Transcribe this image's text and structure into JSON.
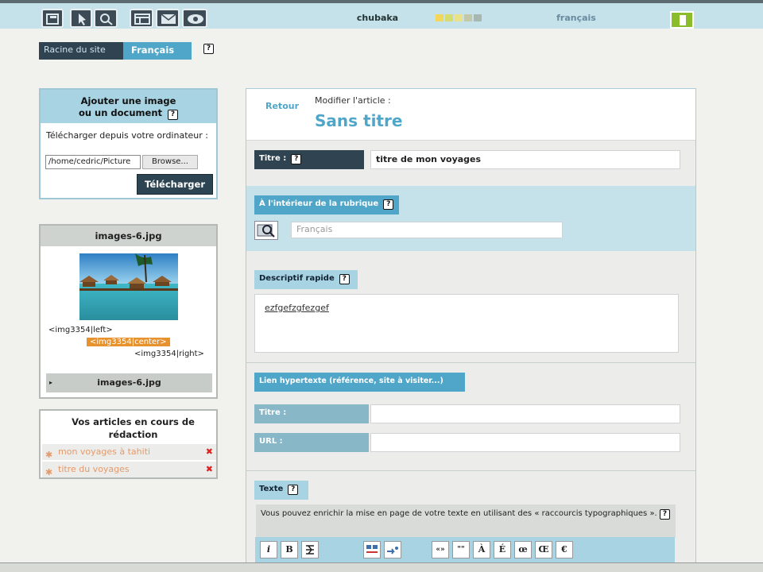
{
  "header": {
    "site_name": "chubaka",
    "language": "français",
    "swatches": [
      "#f4d65b",
      "#d6dd6e",
      "#e9e289",
      "#c3c8a8",
      "#a9b7b2"
    ]
  },
  "breadcrumb": {
    "root": "Racine du site",
    "current": "Français",
    "help": "?"
  },
  "upload": {
    "title": "Ajouter une image\nou un document",
    "help": "?",
    "instructions": "Télécharger depuis votre ordinateur :",
    "file_value": "/home/cedric/Picture",
    "browse_label": "Browse...",
    "submit_label": "Télécharger"
  },
  "image_panel": {
    "filename": "images-6.jpg",
    "tag_left": "<img3354|left>",
    "tag_center": "<img3354|center>",
    "tag_right": "<img3354|right>",
    "footer_arrow": "▸",
    "footer_label": "images-6.jpg"
  },
  "drafts": {
    "title": "Vos articles en cours de rédaction",
    "items": [
      {
        "label": "mon voyages à tahiti"
      },
      {
        "label": "titre du voyages"
      }
    ]
  },
  "article": {
    "back_label": "Retour",
    "edit_label": "Modifier l'article :",
    "title": "Sans titre",
    "title_field": {
      "label": "Titre :",
      "value": "titre de mon voyages"
    },
    "section_field": {
      "label": "À l'intérieur de la rubrique",
      "value": "Français"
    },
    "description": {
      "label": "Descriptif rapide",
      "value": "ezfgefzgfezgef"
    },
    "link": {
      "label": "Lien hypertexte (référence, site à visiter...)",
      "title_label": "Titre :",
      "url_label": "URL :",
      "title_value": "",
      "url_value": ""
    },
    "text": {
      "label": "Texte",
      "help_text": "Vous pouvez enrichir la mise en page de votre texte en utilisant des « raccourcis typographiques »."
    },
    "toolbar": {
      "italic": "i",
      "bold": "B",
      "quotes": "«»",
      "quotes2": "\"\"",
      "a_grave": "À",
      "e_acute": "É",
      "oe": "œ",
      "OE": "Œ",
      "euro": "€"
    }
  }
}
